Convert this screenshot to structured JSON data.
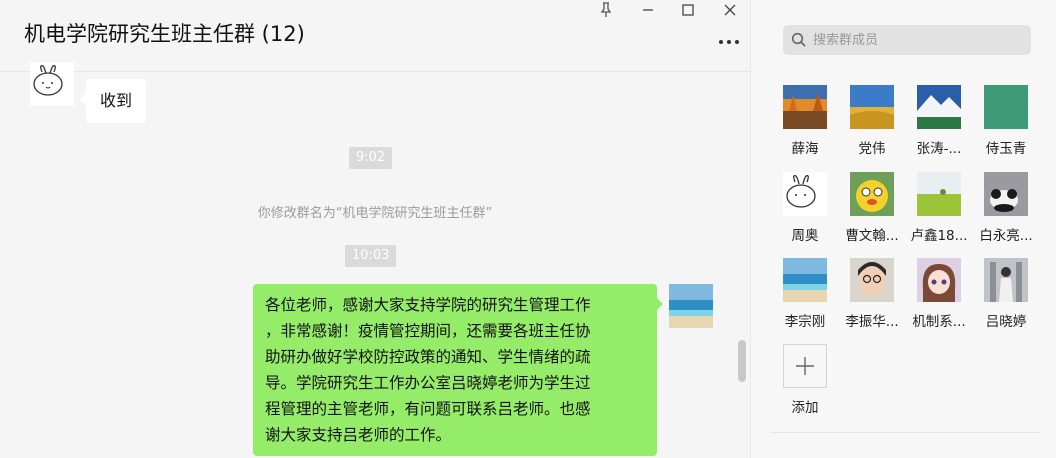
{
  "window": {
    "title": "机电学院研究生班主任群 (12)",
    "controls": [
      "pin-icon",
      "minimize-icon",
      "maximize-icon",
      "close-icon"
    ]
  },
  "messages": [
    {
      "type": "received",
      "sender_avatar": "cartoon-bunny",
      "text": "收到"
    },
    {
      "type": "time",
      "text": "9:02"
    },
    {
      "type": "system",
      "text": "你修改群名为“机电学院研究生班主任群”"
    },
    {
      "type": "time",
      "text": "10:03"
    },
    {
      "type": "sent",
      "sender_avatar": "beach",
      "text": "各位老师，感谢大家支持学院的研究生管理工作\n，非常感谢！疫情管控期间，还需要各班主任协\n助研办做好学校防控政策的通知、学生情绪的疏\n导。学院研究生工作办公室吕晓婷老师为学生过\n程管理的主管老师，有问题可联系吕老师。也感\n谢大家支持吕老师的工作。"
    }
  ],
  "sidebar": {
    "search_placeholder": "搜索群成员",
    "members": [
      {
        "name": "薛海",
        "avatar": "autumn-lake"
      },
      {
        "name": "党伟",
        "avatar": "wheat-sky"
      },
      {
        "name": "张涛-...",
        "avatar": "snow-mountain"
      },
      {
        "name": "侍玉青",
        "avatar": "green-solid"
      },
      {
        "name": "周奥",
        "avatar": "cartoon-bunny"
      },
      {
        "name": "曹文翰...",
        "avatar": "yellow-plush"
      },
      {
        "name": "卢鑫18...",
        "avatar": "grass-field"
      },
      {
        "name": "白永亮...",
        "avatar": "panda"
      },
      {
        "name": "李宗刚",
        "avatar": "beach"
      },
      {
        "name": "李振华...",
        "avatar": "woman-glasses"
      },
      {
        "name": "机制系...",
        "avatar": "anime-girl"
      },
      {
        "name": "吕晓婷",
        "avatar": "girl-photo"
      }
    ],
    "add_label": "添加"
  },
  "colors": {
    "sent_bubble": "#95ec69",
    "received_bubble": "#ffffff",
    "background": "#f5f5f5"
  }
}
